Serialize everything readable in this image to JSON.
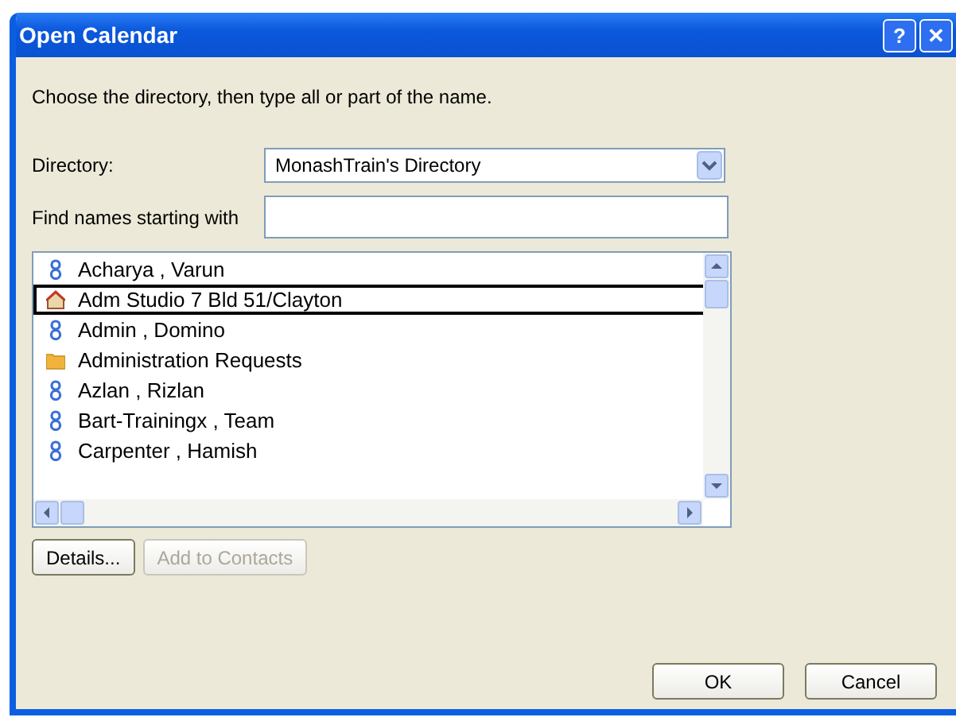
{
  "window": {
    "title": "Open Calendar",
    "buttons": [
      "?",
      "✕"
    ]
  },
  "instruction": "Choose the directory, then type all or part of the name.",
  "directory": {
    "label": "Directory:",
    "value": "MonashTrain's Directory"
  },
  "find": {
    "label": "Find names starting with"
  },
  "names": [
    {
      "kind": "person",
      "name": "Acharya , Varun",
      "selected": false
    },
    {
      "kind": "resource",
      "name": "Adm Studio 7 Bld 51/Clayton",
      "selected": true
    },
    {
      "kind": "person",
      "name": "Admin , Domino",
      "selected": false
    },
    {
      "kind": "folder",
      "name": "Administration Requests",
      "selected": false
    },
    {
      "kind": "person",
      "name": "Azlan , Rizlan",
      "selected": false
    },
    {
      "kind": "person",
      "name": "Bart-Trainingx , Team",
      "selected": false
    },
    {
      "kind": "person",
      "name": "Carpenter , Hamish",
      "selected": false
    }
  ],
  "list_buttons": [
    {
      "label": "Details...",
      "disabled": false
    },
    {
      "label": "Add to Contacts",
      "disabled": true
    }
  ],
  "footer_buttons": [
    "OK",
    "Cancel"
  ]
}
